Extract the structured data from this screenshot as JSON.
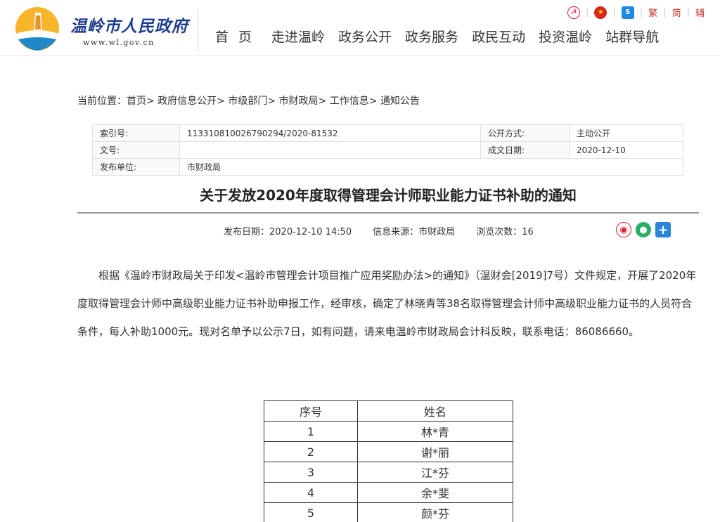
{
  "header": {
    "site_name": "温岭市人民政府",
    "site_url": "www.wl.gov.cn",
    "toplinks": {
      "lang_traditional": "繁",
      "lang_simplified": "简",
      "assist": "辅"
    },
    "nav": [
      "首页",
      "走进温岭",
      "政务公开",
      "政务服务",
      "政民互动",
      "投资温岭",
      "站群导航"
    ]
  },
  "breadcrumb": {
    "prefix": "当前位置：",
    "items": [
      "首页",
      "政府信息公开",
      "市级部门",
      "市财政局",
      "工作信息",
      "通知公告"
    ],
    "separator": "> "
  },
  "meta": {
    "index_label": "索引号:",
    "index_value": "113310810026790294/2020-81532",
    "mode_label": "公开方式:",
    "mode_value": "主动公开",
    "docno_label": "文号:",
    "docno_value": "",
    "date_label": "成文日期:",
    "date_value": "2020-12-10",
    "publisher_label": "发布单位:",
    "publisher_value": "市财政局"
  },
  "article": {
    "title": "关于发放2020年度取得管理会计师职业能力证书补助的通知",
    "publish_label": "发布日期：",
    "publish_date": "2020-12-10 14:50",
    "source_label": "信息来源：",
    "source_value": "市财政局",
    "views_label": "浏览次数：",
    "views_value": "16",
    "body": "根据《温岭市财政局关于印发<温岭市管理会计项目推广应用奖励办法>的通知》（温财会[2019]7号）文件规定，开展了2020年度取得管理会计师中高级职业能力证书补助申报工作，经审核，确定了林晓青等38名取得管理会计师中高级职业能力证书的人员符合条件，每人补助1000元。现对名单予以公示7日，如有问题，请来电温岭市财政局会计科反映，联系电话：86086660。"
  },
  "list_table": {
    "headers": [
      "序号",
      "姓名"
    ],
    "rows": [
      [
        "1",
        "林*青"
      ],
      [
        "2",
        "谢*丽"
      ],
      [
        "3",
        "江*芬"
      ],
      [
        "4",
        "余*斐"
      ],
      [
        "5",
        "颜*芬"
      ]
    ]
  },
  "colors": {
    "brand_blue": "#1d3e8f",
    "accent_red": "#c0392b"
  }
}
